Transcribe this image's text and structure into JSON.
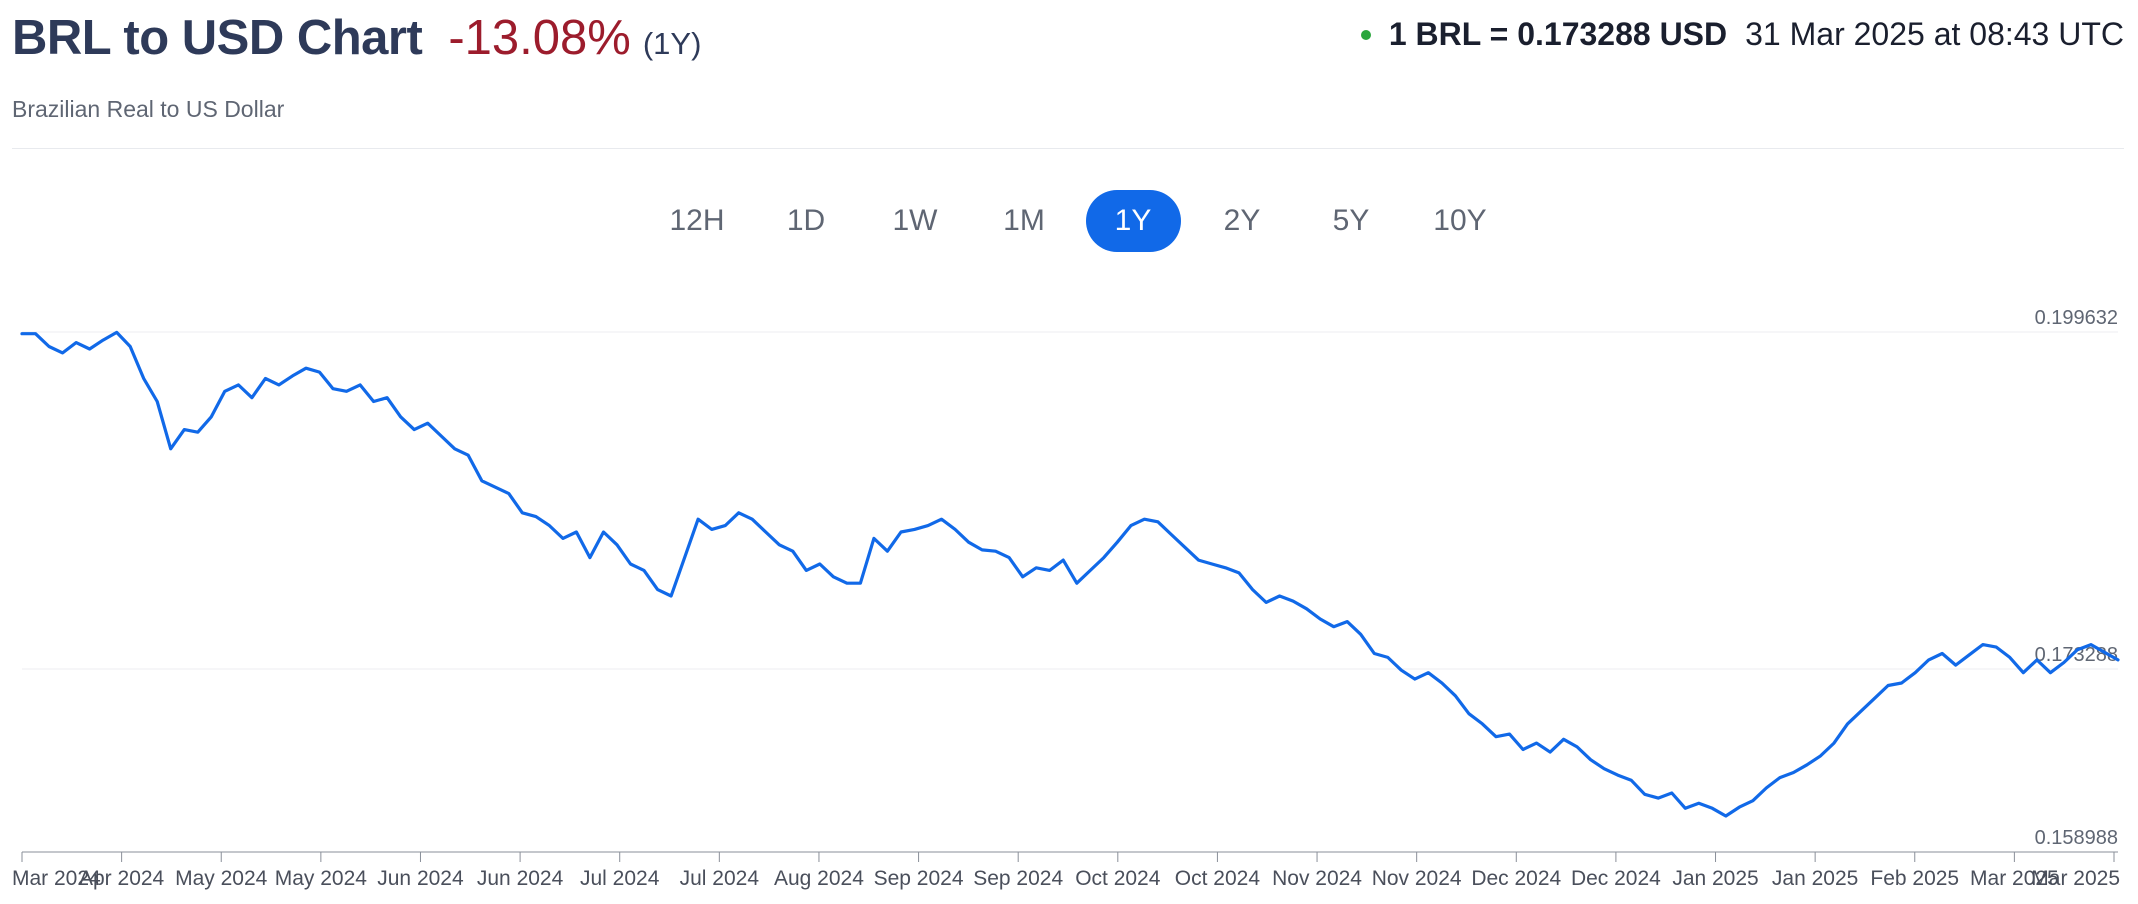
{
  "header": {
    "title": "BRL to USD Chart",
    "change": "-13.08%",
    "period": "(1Y)",
    "subtitle": "Brazilian Real to US Dollar"
  },
  "rate": {
    "value_text": "1 BRL = 0.173288 USD",
    "timestamp": "31 Mar 2025 at 08:43 UTC",
    "status_color": "#2aa63d"
  },
  "tabs": [
    {
      "label": "12H",
      "active": false
    },
    {
      "label": "1D",
      "active": false
    },
    {
      "label": "1W",
      "active": false
    },
    {
      "label": "1M",
      "active": false
    },
    {
      "label": "1Y",
      "active": true
    },
    {
      "label": "2Y",
      "active": false
    },
    {
      "label": "5Y",
      "active": false
    },
    {
      "label": "10Y",
      "active": false
    }
  ],
  "colors": {
    "line": "#1169e8",
    "accent": "#1169e8",
    "negative": "#9c1c2c"
  },
  "chart_data": {
    "type": "line",
    "title": "BRL to USD Chart",
    "ylim": [
      0.158988,
      0.199632
    ],
    "y_ticks": [
      "0.199632",
      "0.173288",
      "0.158988"
    ],
    "x_ticks": [
      "Mar 2024",
      "Apr 2024",
      "May 2024",
      "May 2024",
      "Jun 2024",
      "Jun 2024",
      "Jul 2024",
      "Jul 2024",
      "Aug 2024",
      "Sep 2024",
      "Sep 2024",
      "Oct 2024",
      "Oct 2024",
      "Nov 2024",
      "Nov 2024",
      "Dec 2024",
      "Dec 2024",
      "Jan 2025",
      "Jan 2025",
      "Feb 2025",
      "Mar 2025",
      "Mar 2025"
    ],
    "grid": true,
    "legend": "none",
    "series": [
      {
        "values": [
          0.1995,
          0.1995,
          0.1985,
          0.198,
          0.1988,
          0.1983,
          0.199,
          0.1996,
          0.1985,
          0.196,
          0.1942,
          0.1905,
          0.192,
          0.1918,
          0.193,
          0.195,
          0.1955,
          0.1945,
          0.196,
          0.1955,
          0.1962,
          0.1968,
          0.1965,
          0.1952,
          0.195,
          0.1955,
          0.1942,
          0.1945,
          0.193,
          0.192,
          0.1925,
          0.1915,
          0.1905,
          0.19,
          0.188,
          0.1875,
          0.187,
          0.1855,
          0.1852,
          0.1845,
          0.1835,
          0.184,
          0.182,
          0.184,
          0.183,
          0.1815,
          0.181,
          0.1795,
          0.179,
          0.182,
          0.185,
          0.1842,
          0.1845,
          0.1855,
          0.185,
          0.184,
          0.183,
          0.1825,
          0.181,
          0.1815,
          0.1805,
          0.18,
          0.18,
          0.1835,
          0.1825,
          0.184,
          0.1842,
          0.1845,
          0.185,
          0.1842,
          0.1832,
          0.1826,
          0.1825,
          0.182,
          0.1805,
          0.1812,
          0.181,
          0.1818,
          0.18,
          0.181,
          0.182,
          0.1832,
          0.1845,
          0.185,
          0.1848,
          0.1838,
          0.1828,
          0.1818,
          0.1815,
          0.1812,
          0.1808,
          0.1795,
          0.1785,
          0.179,
          0.1786,
          0.178,
          0.1772,
          0.1766,
          0.177,
          0.176,
          0.1745,
          0.1742,
          0.1732,
          0.1725,
          0.173,
          0.1722,
          0.1712,
          0.1698,
          0.169,
          0.168,
          0.1682,
          0.167,
          0.1675,
          0.1668,
          0.1678,
          0.1672,
          0.1662,
          0.1655,
          0.165,
          0.1646,
          0.1635,
          0.1632,
          0.1636,
          0.1624,
          0.1628,
          0.1624,
          0.1618,
          0.1625,
          0.163,
          0.164,
          0.1648,
          0.1652,
          0.1658,
          0.1665,
          0.1675,
          0.169,
          0.17,
          0.171,
          0.172,
          0.1722,
          0.173,
          0.174,
          0.1745,
          0.1736,
          0.1744,
          0.1752,
          0.175,
          0.1742,
          0.173,
          0.174,
          0.173,
          0.1738,
          0.1748,
          0.1752,
          0.1746,
          0.174
        ],
        "color": "#1169e8"
      }
    ]
  }
}
